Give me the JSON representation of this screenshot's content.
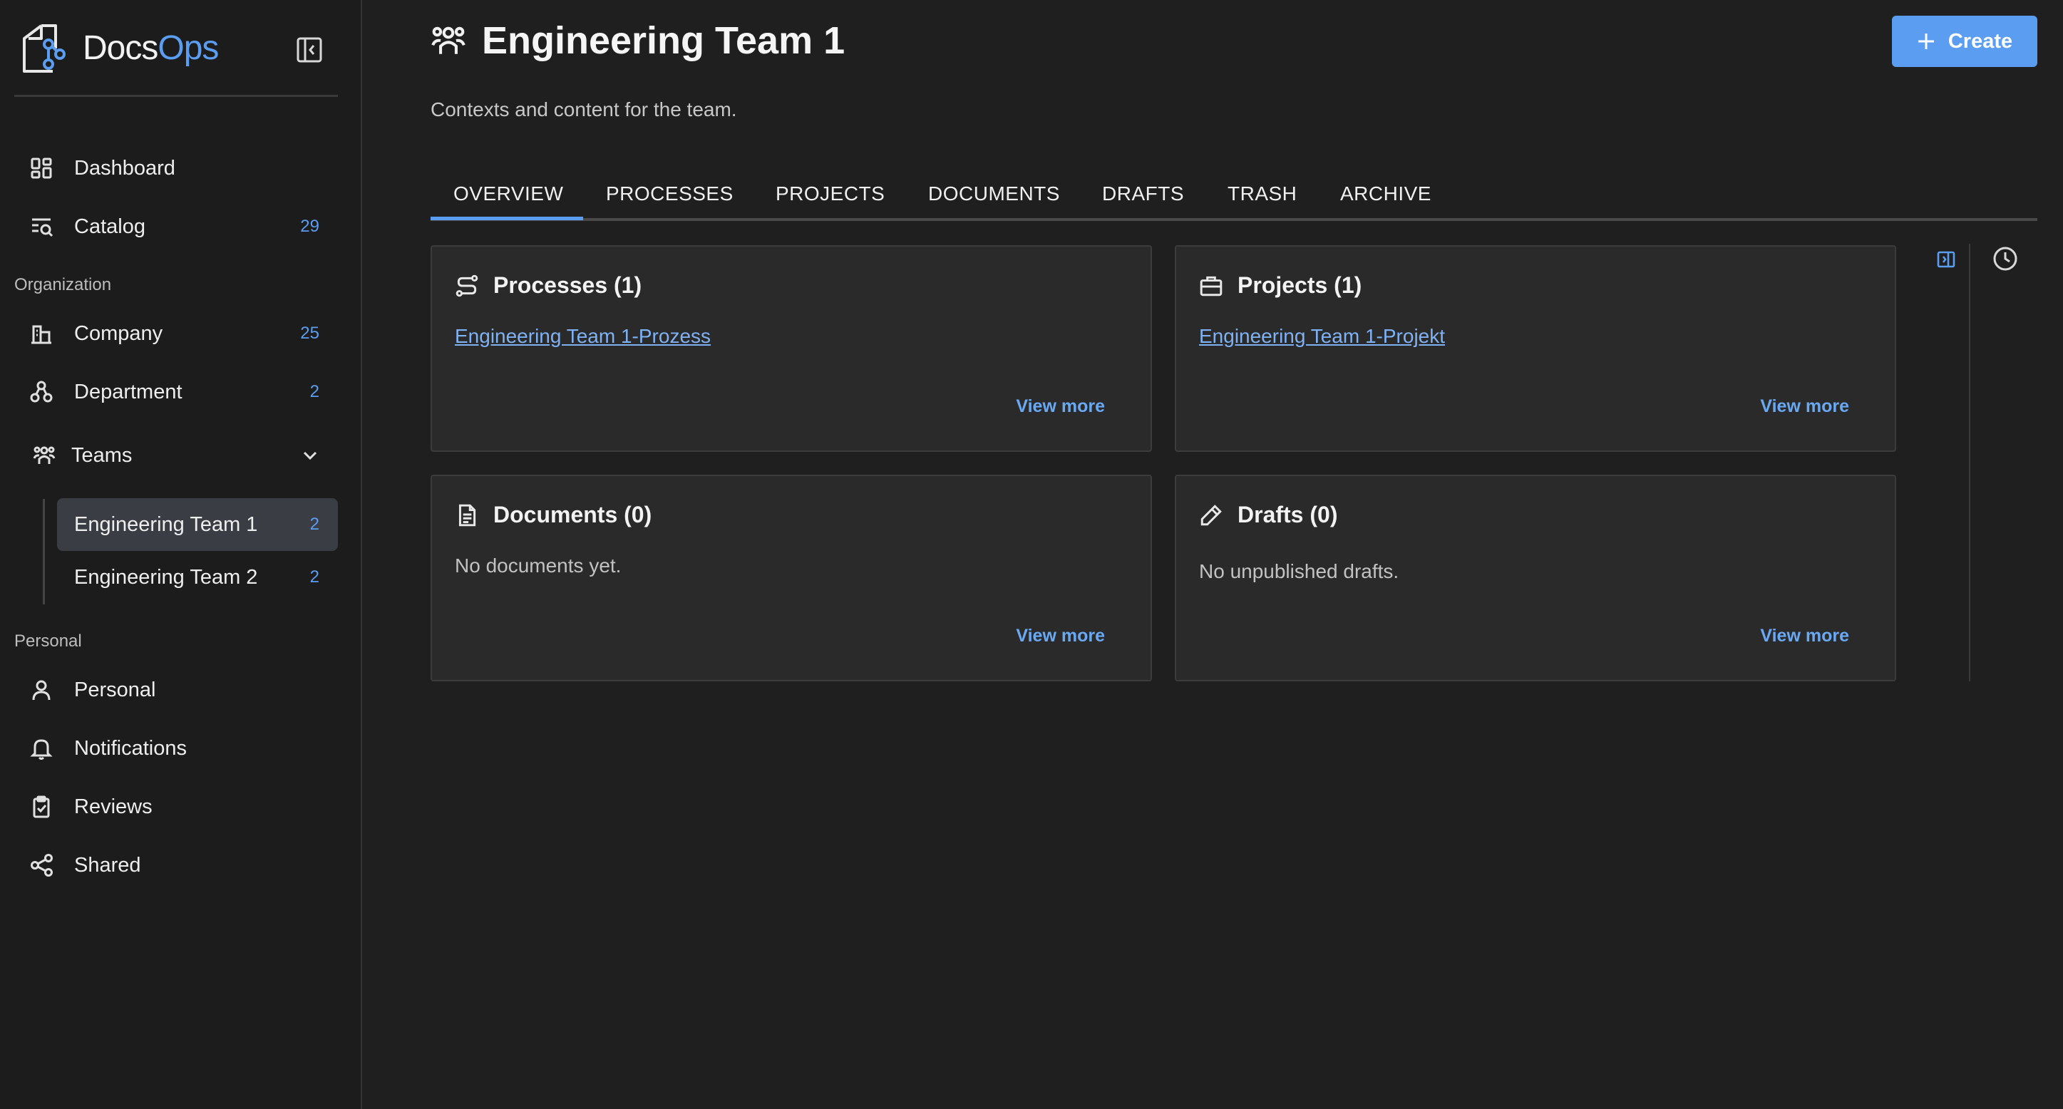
{
  "brand": {
    "name_main": "Docs",
    "name_accent": "Ops",
    "accent_color": "#5b9df0"
  },
  "sidebar": {
    "nav": [
      {
        "label": "Dashboard",
        "icon": "dashboard-icon",
        "count": ""
      },
      {
        "label": "Catalog",
        "icon": "catalog-icon",
        "count": "29"
      }
    ],
    "organization_label": "Organization",
    "organization": [
      {
        "label": "Company",
        "icon": "company-icon",
        "count": "25"
      },
      {
        "label": "Department",
        "icon": "department-icon",
        "count": "2"
      },
      {
        "label": "Teams",
        "icon": "teams-icon",
        "count": ""
      }
    ],
    "teams": [
      {
        "label": "Engineering Team 1",
        "count": "2",
        "active": true
      },
      {
        "label": "Engineering Team 2",
        "count": "2",
        "active": false
      }
    ],
    "personal_label": "Personal",
    "personal": [
      {
        "label": "Personal",
        "icon": "user-icon"
      },
      {
        "label": "Notifications",
        "icon": "bell-icon"
      },
      {
        "label": "Reviews",
        "icon": "clipboard-check-icon"
      },
      {
        "label": "Shared",
        "icon": "share-icon"
      }
    ]
  },
  "header": {
    "title": "Engineering Team 1",
    "subtitle": "Contexts and content for the team.",
    "create_label": "Create"
  },
  "tabs": [
    "OVERVIEW",
    "PROCESSES",
    "PROJECTS",
    "DOCUMENTS",
    "DRAFTS",
    "TRASH",
    "ARCHIVE"
  ],
  "cards": {
    "processes": {
      "title": "Processes (1)",
      "link": "Engineering Team 1-Prozess",
      "view_more": "View more"
    },
    "projects": {
      "title": "Projects (1)",
      "link": "Engineering Team 1-Projekt",
      "view_more": "View more"
    },
    "documents": {
      "title": "Documents (0)",
      "empty": "No documents yet.",
      "view_more": "View more"
    },
    "drafts": {
      "title": "Drafts (0)",
      "empty": "No unpublished drafts.",
      "view_more": "View more"
    }
  }
}
